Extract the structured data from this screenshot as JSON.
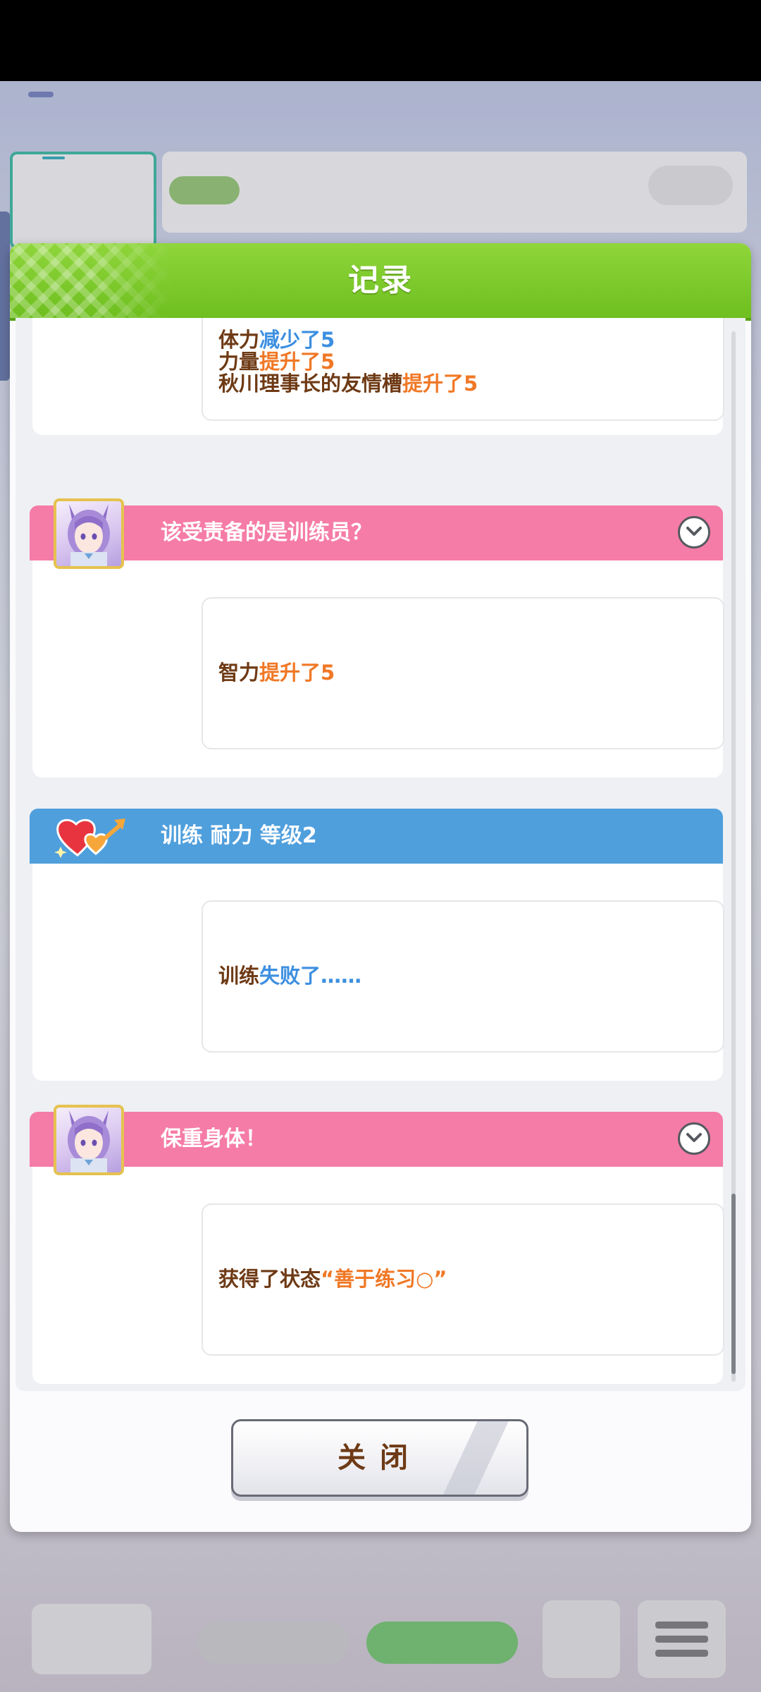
{
  "dialog": {
    "title": "记录",
    "close_label": "关闭"
  },
  "entries": [
    {
      "type": "partial",
      "lines": [
        {
          "prefix": "体力",
          "highlight": "减少了5",
          "color": "blue"
        },
        {
          "prefix": "力量",
          "highlight": "提升了5",
          "color": "orange"
        },
        {
          "prefix": "秋川理事长的友情槽",
          "highlight": "提升了5",
          "color": "orange"
        }
      ]
    },
    {
      "type": "event",
      "header_color": "#f57ca6",
      "title": "该受责备的是训练员？",
      "icon": "character-portrait",
      "lines": [
        {
          "prefix": "智力",
          "highlight": "提升了5",
          "color": "orange"
        }
      ]
    },
    {
      "type": "training",
      "header_color": "#4f9fdd",
      "title": "训练 耐力 等级2",
      "icon": "heart-arrow-icon",
      "lines": [
        {
          "prefix": "训练",
          "highlight": "失败了……",
          "color": "blue"
        }
      ]
    },
    {
      "type": "event",
      "header_color": "#f57ca6",
      "title": "保重身体！",
      "icon": "character-portrait",
      "lines": [
        {
          "prefix": "获得了状态",
          "highlight": "“善于练习○”",
          "color": "orange"
        }
      ]
    }
  ],
  "colors": {
    "header_green": "#7ccb2a",
    "event_pink": "#f57ca6",
    "training_blue": "#4f9fdd",
    "text_brown": "#6e3a15",
    "increase_orange": "#f07826",
    "decrease_blue": "#3c8fe0"
  }
}
